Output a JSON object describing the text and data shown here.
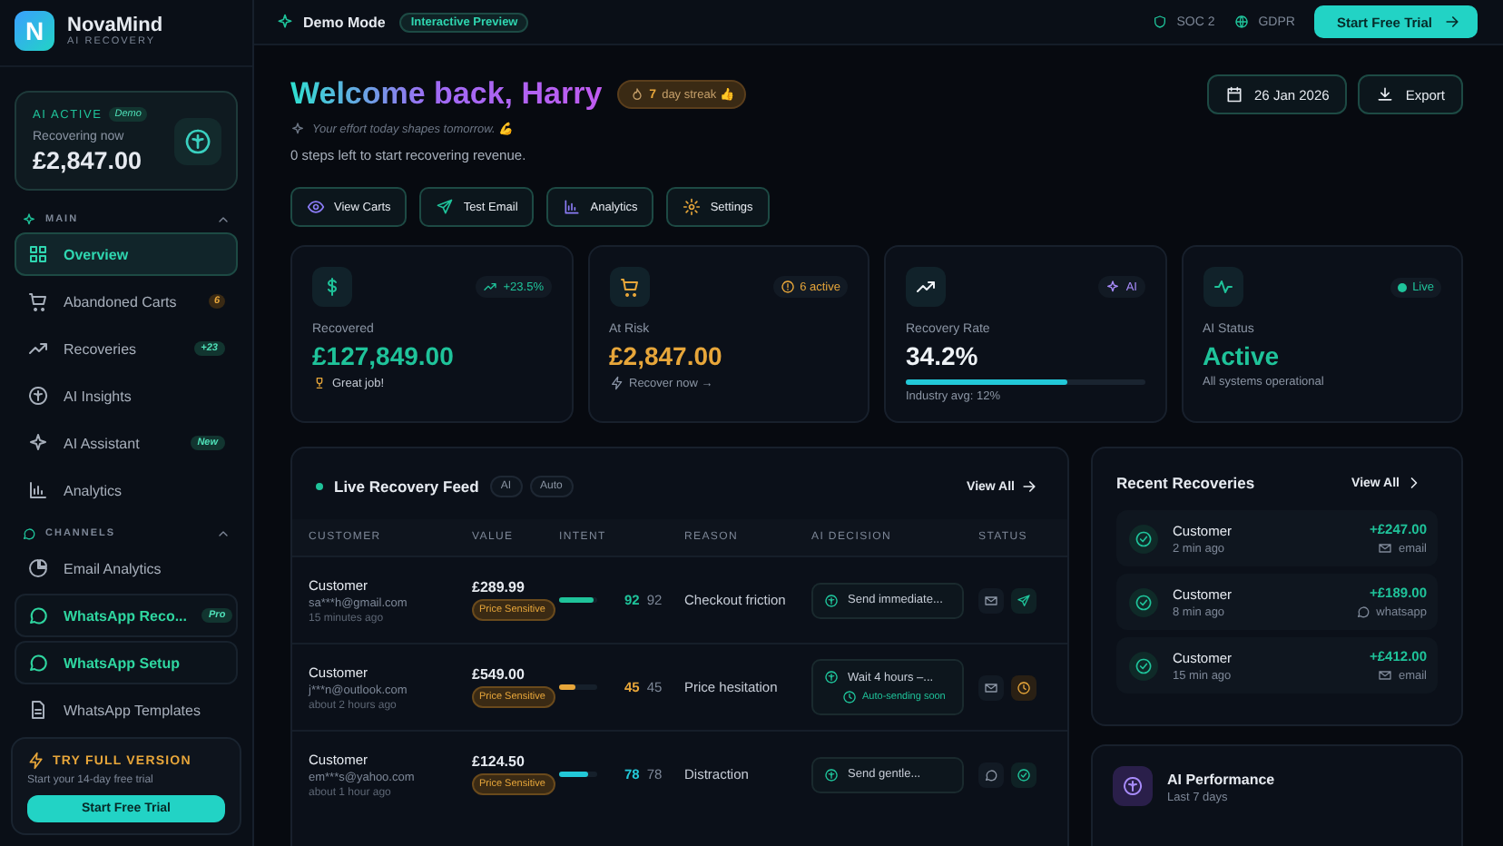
{
  "brand": {
    "name": "NovaMind",
    "subtitle": "AI RECOVERY",
    "logo": "N"
  },
  "ai_card": {
    "status": "AI ACTIVE",
    "badge": "Demo",
    "label": "Recovering now",
    "amount": "£2,847.00"
  },
  "nav_sections": [
    {
      "title": "MAIN",
      "expanded": true,
      "items": [
        {
          "label": "Overview",
          "selected": true,
          "highlighted": false
        },
        {
          "label": "Abandoned Carts",
          "selected": false,
          "highlighted": false,
          "badge": "6",
          "kind": "warn"
        },
        {
          "label": "Recoveries",
          "selected": false,
          "highlighted": false,
          "badge": "+23",
          "kind": "info"
        },
        {
          "label": "AI Insights",
          "selected": false,
          "highlighted": false
        },
        {
          "label": "AI Assistant",
          "selected": false,
          "highlighted": false,
          "badge": "New",
          "kind": "new"
        },
        {
          "label": "Analytics",
          "selected": false,
          "highlighted": false
        }
      ]
    },
    {
      "title": "CHANNELS",
      "expanded": true,
      "items": [
        {
          "label": "Email Analytics",
          "selected": false,
          "highlighted": false
        },
        {
          "label": "WhatsApp Reco...",
          "selected": false,
          "highlighted": true,
          "badge": "Pro",
          "kind": "info"
        },
        {
          "label": "WhatsApp Setup",
          "selected": false,
          "highlighted": true
        },
        {
          "label": "WhatsApp Templates",
          "selected": false,
          "highlighted": false
        }
      ]
    }
  ],
  "promo": {
    "title": "TRY FULL VERSION",
    "text": "Start your 14-day free trial",
    "button": "Start Free Trial"
  },
  "topbar": {
    "mode": "Demo Mode",
    "badge": "Interactive Preview",
    "compliance": [
      "SOC 2",
      "GDPR"
    ],
    "cta": "Start Free Trial"
  },
  "welcome": {
    "title": "Welcome back, Harry",
    "streak_count": "7",
    "streak_label": "day streak 👍",
    "motto": "Your effort today shapes tomorrow. 💪",
    "steps": "0 steps left to start recovering revenue.",
    "date": "26 Jan 2026",
    "export": "Export"
  },
  "quick_actions": [
    "View Carts",
    "Test Email",
    "Analytics",
    "Settings"
  ],
  "stats": [
    {
      "label": "Recovered",
      "value": "£127,849.00",
      "note": "Great job!",
      "badge": "+23.5%",
      "color": "#1fc39a"
    },
    {
      "label": "At Risk",
      "value": "£2,847.00",
      "note": "Recover now →",
      "badge": "6 active",
      "color": "#e7a63a"
    },
    {
      "label": "Recovery Rate",
      "value": "34.2%",
      "note": "Industry avg: 12%",
      "badge": "AI",
      "color": "#eef2f6",
      "level": 0.68
    },
    {
      "label": "AI Status",
      "value": "Active",
      "note": "All systems operational",
      "badge": "Live",
      "color": "#1fc39a"
    }
  ],
  "feed": {
    "title": "Live Recovery Feed",
    "tags": [
      "AI",
      "Auto"
    ],
    "view_all": "View All",
    "columns": [
      "CUSTOMER",
      "VALUE",
      "INTENT",
      "REASON",
      "AI DECISION",
      "STATUS"
    ],
    "rows": [
      {
        "name": "Customer",
        "email": "sa***h@gmail.com",
        "time": "15 minutes ago",
        "value": "£289.99",
        "tag": "Price Sensitive",
        "level": 0.92,
        "score": "92",
        "score_plain": "92",
        "color": "#1fc39a",
        "reason": "Checkout friction",
        "decision": "Send immediate...",
        "status_icons": [
          {
            "kind": "email"
          },
          {
            "kind": "sent"
          }
        ]
      },
      {
        "name": "Customer",
        "email": "j***n@outlook.com",
        "time": "about 2 hours ago",
        "value": "£549.00",
        "tag": "Price Sensitive",
        "level": 0.45,
        "score": "45",
        "score_plain": "45",
        "color": "#e7a63a",
        "reason": "Price hesitation",
        "decision": "Wait 4 hours –...",
        "decision_note": "Auto-sending soon",
        "status_icons": [
          {
            "kind": "email"
          },
          {
            "kind": "scheduled"
          }
        ]
      },
      {
        "name": "Customer",
        "email": "em***s@yahoo.com",
        "time": "about 1 hour ago",
        "value": "£124.50",
        "tag": "Price Sensitive",
        "level": 0.78,
        "score": "78",
        "score_plain": "78",
        "color": "#22c8d8",
        "reason": "Distraction",
        "decision": "Send gentle...",
        "status_icons": [
          {
            "kind": "chat"
          },
          {
            "kind": "delivered"
          }
        ]
      }
    ]
  },
  "recent": {
    "title": "Recent Recoveries",
    "view_all": "View All",
    "items": [
      {
        "name": "Customer",
        "time": "2 min ago",
        "amount": "+£247.00",
        "channel": "email",
        "kind": "email"
      },
      {
        "name": "Customer",
        "time": "8 min ago",
        "amount": "+£189.00",
        "channel": "whatsapp",
        "kind": "chat"
      },
      {
        "name": "Customer",
        "time": "15 min ago",
        "amount": "+£412.00",
        "channel": "email",
        "kind": "email"
      }
    ]
  },
  "performance": {
    "title": "AI Performance",
    "subtitle": "Last 7 days"
  }
}
